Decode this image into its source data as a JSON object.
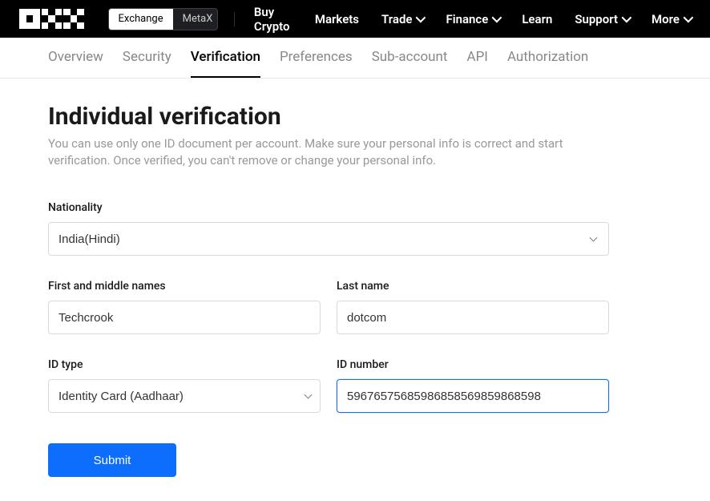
{
  "header": {
    "toggle": {
      "exchange": "Exchange",
      "metax": "MetaX",
      "active": "exchange"
    },
    "nav": {
      "buy_crypto": "Buy Crypto",
      "markets": "Markets",
      "trade": "Trade",
      "finance": "Finance",
      "learn": "Learn",
      "support": "Support",
      "more": "More"
    }
  },
  "subnav": {
    "overview": "Overview",
    "security": "Security",
    "verification": "Verification",
    "preferences": "Preferences",
    "sub_account": "Sub-account",
    "api": "API",
    "authorization": "Authorization",
    "active": "verification"
  },
  "page": {
    "title": "Individual verification",
    "description": "You can use only one ID document per account. Make sure your personal info is correct and start verification. Once verified, you can't remove or change your personal info."
  },
  "form": {
    "nationality": {
      "label": "Nationality",
      "value": "India(Hindi)"
    },
    "first_name": {
      "label": "First and middle names",
      "value": "Techcrook"
    },
    "last_name": {
      "label": "Last name",
      "value": "dotcom"
    },
    "id_type": {
      "label": "ID type",
      "value": "Identity Card (Aadhaar)"
    },
    "id_number": {
      "label": "ID number",
      "value": "59676575685986858569859868598"
    },
    "submit": "Submit"
  }
}
